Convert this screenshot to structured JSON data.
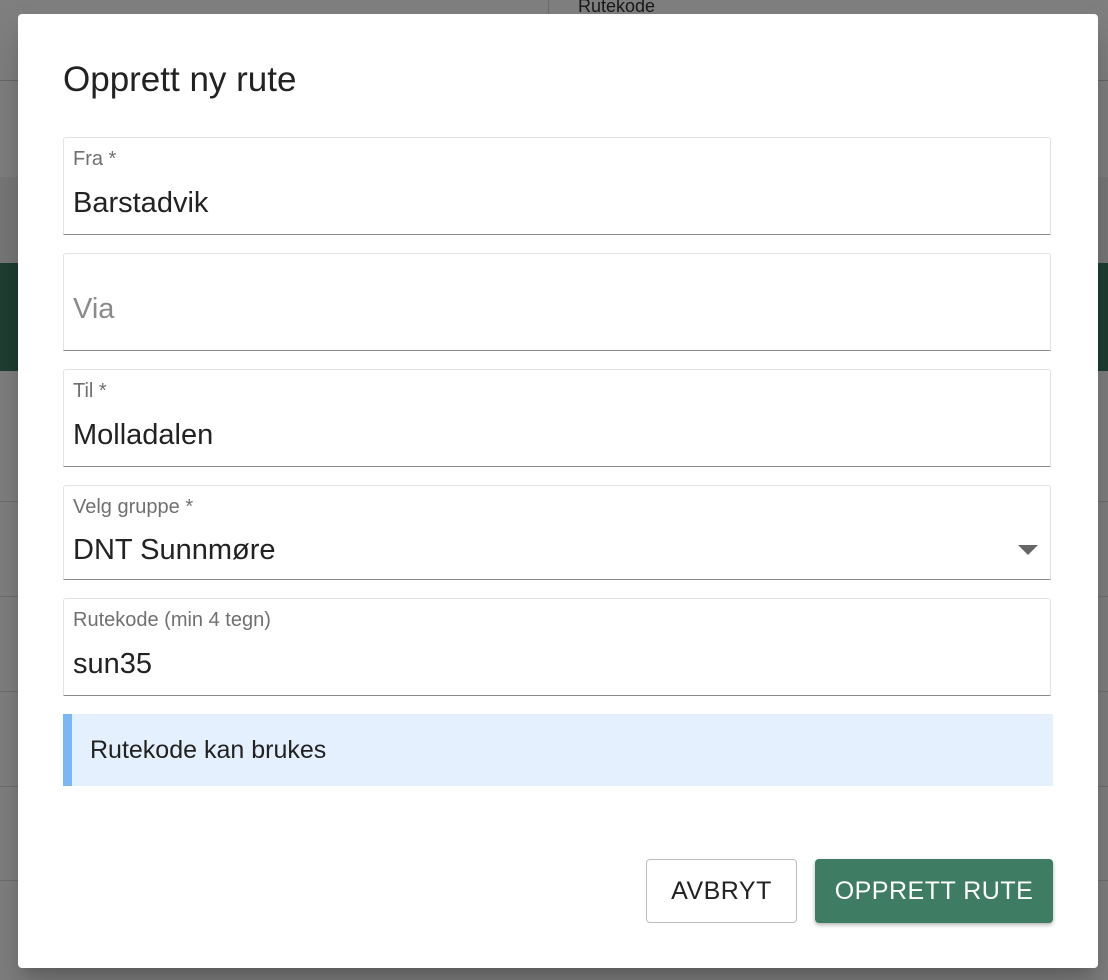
{
  "background": {
    "column_header": "Rutekode"
  },
  "dialog": {
    "title": "Opprett ny rute",
    "fields": {
      "from": {
        "label": "Fra *",
        "value": "Barstadvik"
      },
      "via": {
        "placeholder": "Via",
        "value": ""
      },
      "to": {
        "label": "Til *",
        "value": "Molladalen"
      },
      "group": {
        "label": "Velg gruppe *",
        "value": "DNT Sunnmøre"
      },
      "route_code": {
        "label": "Rutekode (min 4 tegn)",
        "value": "sun35"
      }
    },
    "notice": "Rutekode kan brukes",
    "buttons": {
      "cancel": "AVBRYT",
      "create": "OPPRETT RUTE"
    }
  },
  "colors": {
    "primary_green": "#3e7d63",
    "notice_bg": "#e4f0fd",
    "notice_border": "#7ab8f5"
  }
}
